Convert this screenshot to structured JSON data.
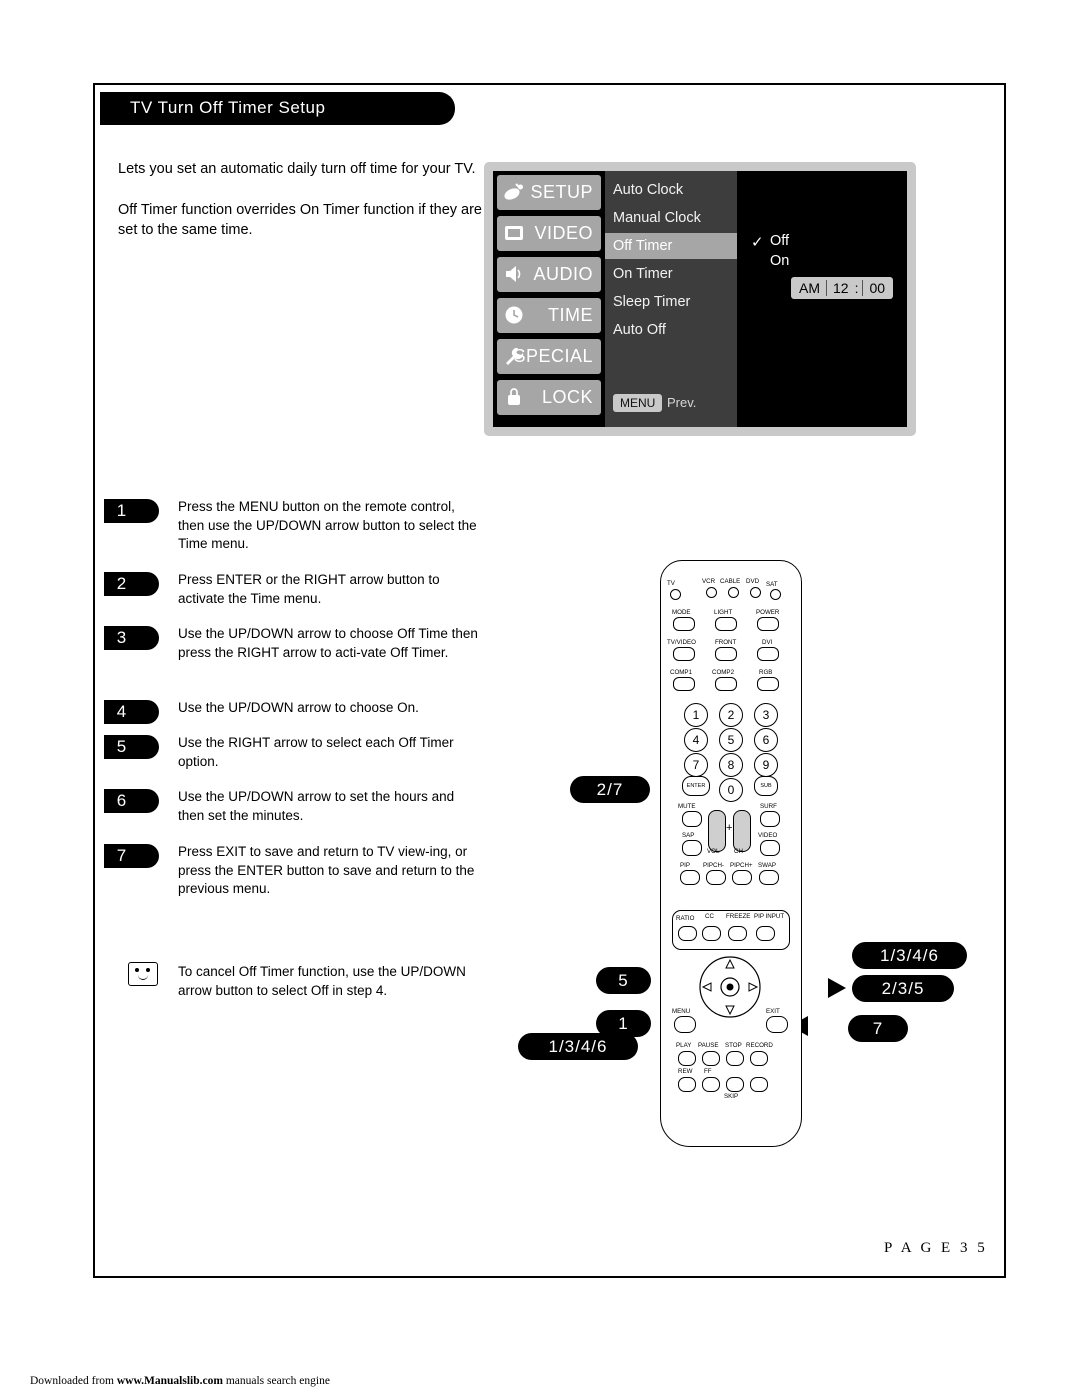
{
  "page": {
    "title": "TV Turn Off Timer Setup",
    "page_label": "P A G E  3 5",
    "footer": "Downloaded from www.Manualslib.com manuals search engine",
    "footer_link": "www.Manualslib.com"
  },
  "intro": {
    "line1": "Lets you set an automatic daily turn off time for your TV.",
    "line2": "Off Timer function overrides On Timer function if they are both set to the same time."
  },
  "osd": {
    "tabs": [
      {
        "label": "SETUP",
        "icon": "satellite-dish-icon"
      },
      {
        "label": "VIDEO",
        "icon": "tv-icon"
      },
      {
        "label": "AUDIO",
        "icon": "speaker-icon"
      },
      {
        "label": "TIME",
        "icon": "clock-icon"
      },
      {
        "label": "SPECIAL",
        "icon": "wrench-icon"
      },
      {
        "label": "LOCK",
        "icon": "padlock-icon"
      }
    ],
    "items": [
      {
        "label": "Auto Clock",
        "selected": false
      },
      {
        "label": "Manual Clock",
        "selected": false
      },
      {
        "label": "Off Timer",
        "selected": true
      },
      {
        "label": "On Timer",
        "selected": false
      },
      {
        "label": "Sleep Timer",
        "selected": false
      },
      {
        "label": "Auto Off",
        "selected": false
      }
    ],
    "options": [
      {
        "label": "Off",
        "checked": true
      },
      {
        "label": "On",
        "checked": false
      }
    ],
    "time": {
      "meridiem": "AM",
      "hour": "12",
      "separator": ":",
      "minute": "00"
    },
    "menu_button": "MENU",
    "menu_prev": "Prev."
  },
  "steps": [
    {
      "num": "1",
      "text": "Press the MENU button on the remote control, then use the UP/DOWN arrow button to select the Time menu."
    },
    {
      "num": "2",
      "text": "Press ENTER or the RIGHT arrow button to activate the Time menu."
    },
    {
      "num": "3",
      "text": "Use the UP/DOWN arrow to choose Off Time then press the RIGHT arrow to acti-vate Off Timer."
    },
    {
      "num": "4",
      "text": "Use the UP/DOWN arrow to choose On."
    },
    {
      "num": "5",
      "text": "Use the RIGHT arrow to select each Off Timer option."
    },
    {
      "num": "6",
      "text": "Use the UP/DOWN arrow to set the hours and then set the minutes."
    },
    {
      "num": "7",
      "text": "Press EXIT to save and return to TV view-ing, or press the ENTER button to save and return to the previous menu."
    }
  ],
  "note": {
    "icon": "note-face-icon",
    "text": "To cancel Off Timer function, use the UP/DOWN arrow button to select Off in step 4."
  },
  "callouts": {
    "left_mid": "2/7",
    "nav_left": "5",
    "menu_left": "1",
    "bottom_left": "1/3/4/6",
    "right_top": "1/3/4/6",
    "right_mid": "2/3/5",
    "right_bottom": "7"
  },
  "remote": {
    "device_labels": [
      "TV",
      "VCR",
      "CABLE",
      "DVD",
      "SAT"
    ],
    "row_mode": [
      "MODE",
      "LIGHT",
      "POWER"
    ],
    "row_input": [
      "TV/VIDEO",
      "FRONT",
      "DVI"
    ],
    "row_comp": [
      "COMP1",
      "COMP2",
      "RGB"
    ],
    "keypad": [
      "1",
      "2",
      "3",
      "4",
      "5",
      "6",
      "7",
      "8",
      "9",
      "0"
    ],
    "enter": "ENTER",
    "sub": "SUB",
    "mute": "MUTE",
    "surf": "SURF",
    "sap": "SAP",
    "video": "VIDEO",
    "vol": "VOL",
    "ch": "CH",
    "pip_row": [
      "PIP",
      "PIPCH-",
      "PIPCH+",
      "SWAP"
    ],
    "ratio": "RATIO",
    "cc": "CC",
    "freeze": "FREEZE",
    "pip_input": "PIP INPUT",
    "menu": "MENU",
    "exit": "EXIT",
    "transport": [
      "PLAY",
      "PAUSE",
      "STOP",
      "RECORD"
    ],
    "transport2": [
      "REW",
      "FF"
    ],
    "skip": "SKIP"
  }
}
